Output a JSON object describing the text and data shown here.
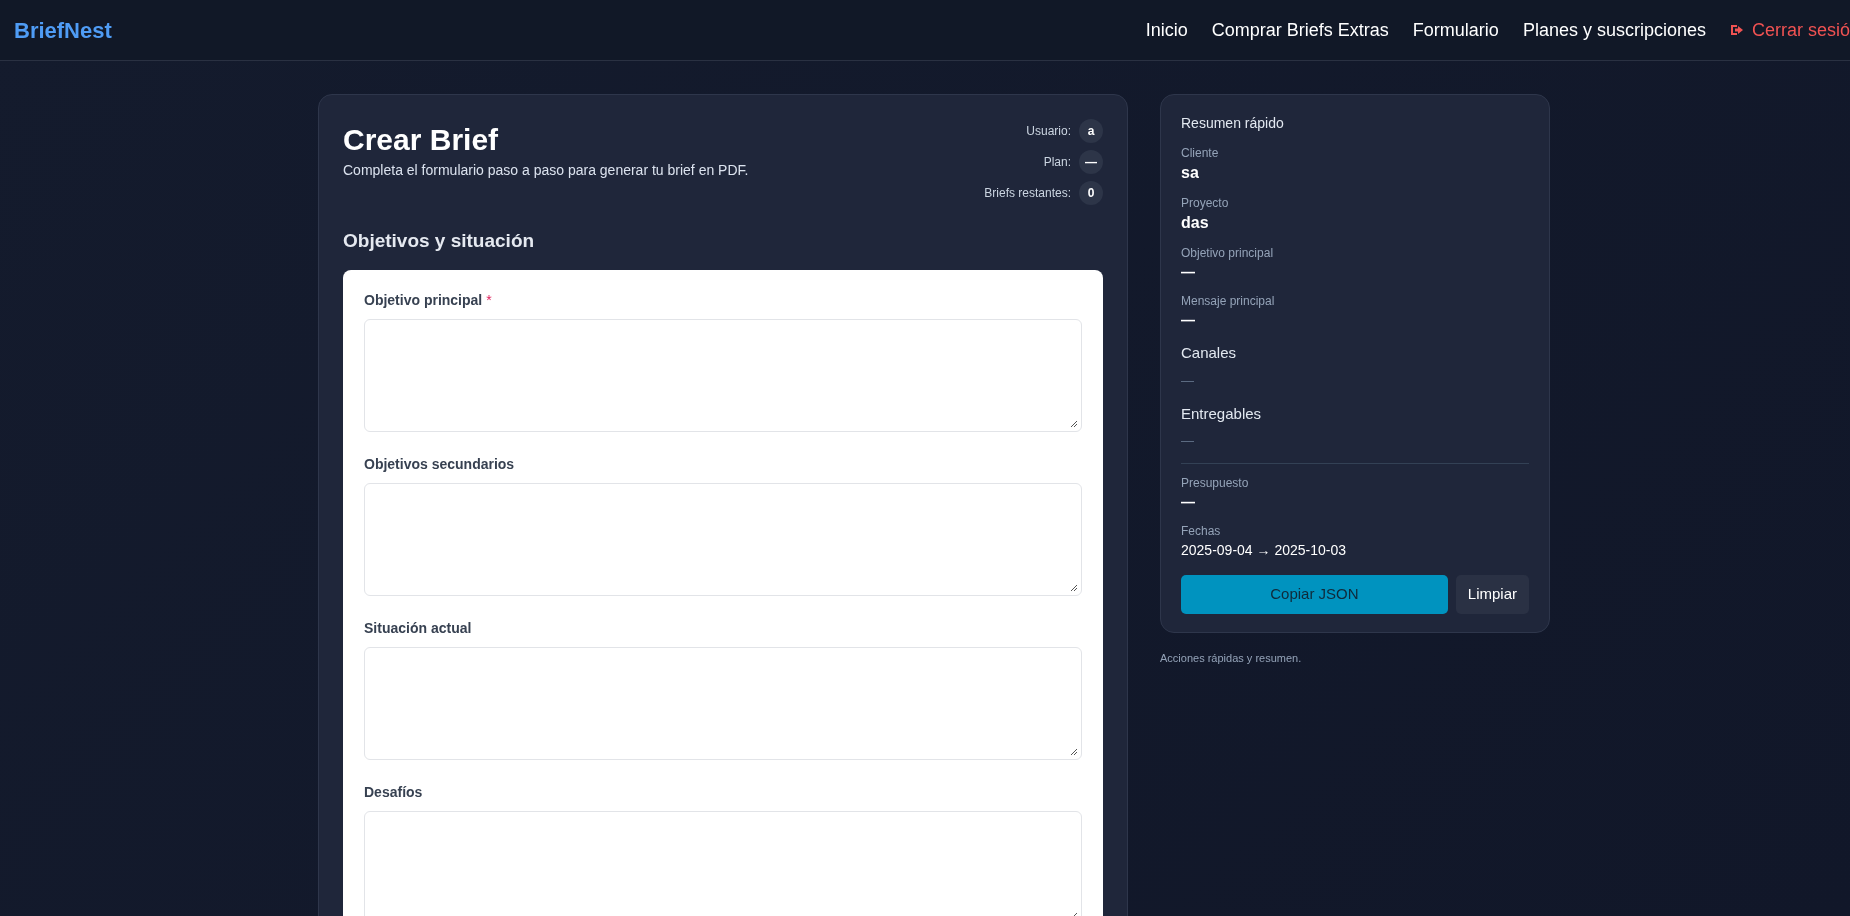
{
  "header": {
    "logo": "BriefNest",
    "nav": [
      {
        "label": "Inicio",
        "kind": "link"
      },
      {
        "label": "Comprar Briefs Extras",
        "kind": "link"
      },
      {
        "label": "Formulario",
        "kind": "link"
      },
      {
        "label": "Planes y suscripciones",
        "kind": "link"
      },
      {
        "label": "Cerrar sesió",
        "kind": "logout"
      }
    ]
  },
  "form_card": {
    "title": "Crear Brief",
    "subtitle": "Completa el formulario paso a paso para generar tu brief en PDF.",
    "stats": [
      {
        "label": "Usuario:",
        "value": "a"
      },
      {
        "label": "Plan:",
        "value": "—"
      },
      {
        "label": "Briefs restantes:",
        "value": "0"
      }
    ],
    "section_title": "Objetivos y situación",
    "fields": [
      {
        "label": "Objetivo principal",
        "required_mark": "*"
      },
      {
        "label": "Objetivos secundarios"
      },
      {
        "label": "Situación actual"
      },
      {
        "label": "Desafíos"
      }
    ]
  },
  "summary": {
    "title": "Resumen rápido",
    "items": [
      {
        "kind": "strong",
        "label": "Cliente",
        "value": "sa"
      },
      {
        "kind": "strong",
        "label": "Proyecto",
        "value": "das"
      },
      {
        "kind": "dash",
        "label": "Objetivo principal",
        "value": "—"
      },
      {
        "kind": "dash",
        "label": "Mensaje principal",
        "value": "—"
      },
      {
        "kind": "group",
        "label": "Canales",
        "value": "—"
      },
      {
        "kind": "group",
        "label": "Entregables",
        "value": "—"
      }
    ],
    "details": [
      {
        "kind": "dash",
        "label": "Presupuesto",
        "value": "—"
      },
      {
        "kind": "plain",
        "label": "Fechas",
        "value": "2025-09-04 → 2025-10-03"
      }
    ],
    "buttons": [
      {
        "label": "Copiar JSON",
        "kind": "primary"
      },
      {
        "label": "Limpiar",
        "kind": "secondary"
      }
    ],
    "caption": "Acciones rápidas y resumen."
  }
}
